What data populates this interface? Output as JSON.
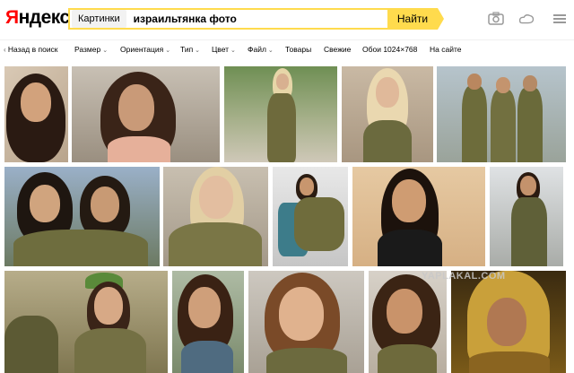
{
  "header": {
    "logo": "Яндекс",
    "service_tab": "Картинки",
    "query": "израильтянка фото",
    "search_button": "Найти"
  },
  "filters": {
    "back": "Назад в поиск",
    "size": "Размер",
    "orientation": "Ориентация",
    "type": "Тип",
    "color": "Цвет",
    "file": "Файл",
    "products": "Товары",
    "fresh": "Свежие",
    "wallpapers": "Обои 1024×768",
    "on_site": "На сайте"
  },
  "icons": {
    "camera": "camera-icon",
    "cloud": "cloud-icon",
    "menu": "menu-icon",
    "clear": "clear-icon",
    "chevron": "chevron-down-icon",
    "back": "chevron-left-icon"
  },
  "colors": {
    "accent": "#ffdb4d",
    "logo_red": "#ff0000"
  },
  "watermark": "YAPLAKAL.COM"
}
